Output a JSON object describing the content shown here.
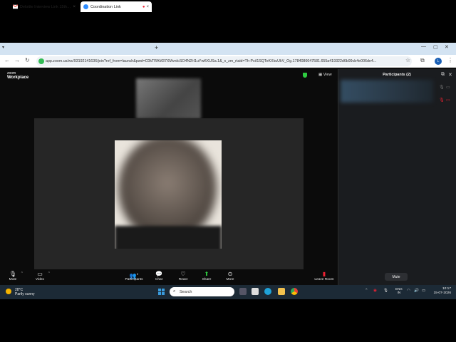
{
  "browser": {
    "tabs": [
      {
        "title": "Deloitte Interview Link 15th Ju",
        "favicon": "gmail-icon",
        "active": false
      },
      {
        "title": "Coordination Link",
        "favicon": "zoom-icon",
        "active": true
      }
    ],
    "url": "app.zoom.us/wc/93192141636/join?ref_from=launch&pwd=C0kTRAM37XMvrdcSO4N2H1uYwKKUSa.1&_x_zm_rtaid=Th-PxiI1SQTeKXkuUkV_Og.1784086647581.655a419322d6b99cb4e006de4...",
    "profile_initial": "L"
  },
  "zoom": {
    "brand_small": "zoom",
    "brand_large": "Workplace",
    "view_label": "View",
    "panel": {
      "title": "Participants (2)",
      "mute_label": "Mute"
    },
    "toolbar": {
      "mute": "Mute",
      "video": "Video",
      "participants": "Participants",
      "participants_count": "2",
      "chat": "Chat",
      "react": "React",
      "share": "Share",
      "more": "More",
      "leave": "Leave Room"
    }
  },
  "taskbar": {
    "weather_temp": "28°C",
    "weather_desc": "Partly sunny",
    "search_placeholder": "Search",
    "lang_top": "ENG",
    "lang_bottom": "IN",
    "time": "10:17",
    "date": "15-07-2026"
  }
}
